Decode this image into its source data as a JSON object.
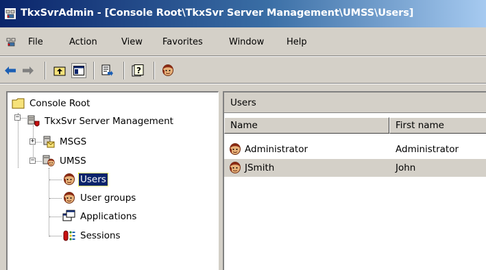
{
  "window": {
    "title": "TkxSvrAdmin - [Console Root\\TkxSvr Server Management\\UMSS\\Users]"
  },
  "menu": {
    "items": [
      "File",
      "Action",
      "View",
      "Favorites",
      "Window",
      "Help"
    ]
  },
  "toolbar": {
    "buttons": [
      "back-arrow",
      "forward-arrow",
      "up-folder",
      "show-hide-tree",
      "export-list",
      "help",
      "user-tool"
    ]
  },
  "tree": {
    "root": "Console Root",
    "server": "TkxSvr Server Management",
    "msgs": "MSGS",
    "umss": "UMSS",
    "users": "Users",
    "user_groups": "User groups",
    "applications": "Applications",
    "sessions": "Sessions",
    "selected": "Users"
  },
  "details": {
    "header": "Users",
    "columns": [
      "Name",
      "First name"
    ],
    "rows": [
      {
        "name": "Administrator",
        "first_name": "Administrator"
      },
      {
        "name": "JSmith",
        "first_name": "John"
      }
    ]
  }
}
